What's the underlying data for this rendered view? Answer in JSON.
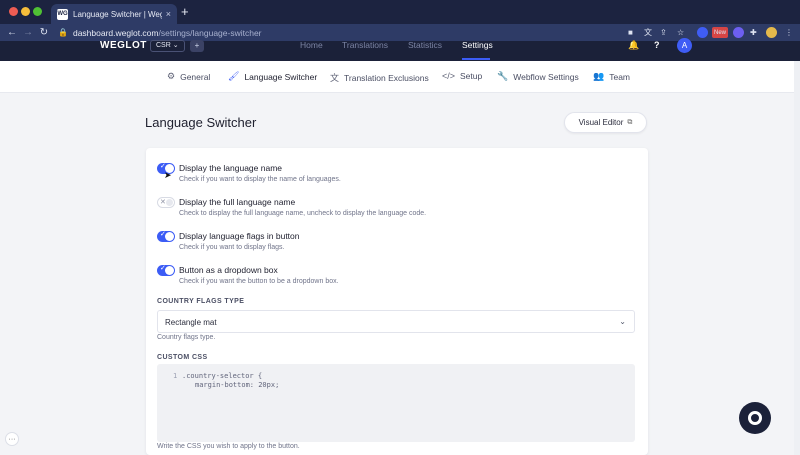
{
  "browser": {
    "tab_title": "Language Switcher | Weglot",
    "favicon_text": "WG",
    "new_tab_label": "+",
    "tab_close": "×",
    "url_host": "dashboard.weglot.com",
    "url_path": "/settings/language-switcher",
    "extension_badge": "New"
  },
  "app": {
    "logo": "WEGLOT",
    "project": "CSR ⌄",
    "project_add": "+",
    "nav": [
      "Home",
      "Translations",
      "Statistics",
      "Settings"
    ],
    "active_nav": "Settings",
    "avatar_initial": "A"
  },
  "subnav": [
    {
      "icon": "gear-icon",
      "glyph": "⚙",
      "label": "General",
      "active": false
    },
    {
      "icon": "paint-roller-icon",
      "glyph": "🖌",
      "label": "Language Switcher",
      "active": true
    },
    {
      "icon": "translate-icon",
      "glyph": "文",
      "label": "Translation Exclusions",
      "active": false
    },
    {
      "icon": "code-icon",
      "glyph": "</>",
      "label": "Setup",
      "active": false
    },
    {
      "icon": "wrench-icon",
      "glyph": "🔧",
      "label": "Webflow Settings",
      "active": false
    },
    {
      "icon": "team-icon",
      "glyph": "👥",
      "label": "Team",
      "active": false
    }
  ],
  "page": {
    "title": "Language Switcher",
    "visual_editor": "Visual Editor"
  },
  "options": [
    {
      "label": "Display the language name",
      "help": "Check if you want to display the name of languages.",
      "enabled": true
    },
    {
      "label": "Display the full language name",
      "help": "Check to display the full language name, uncheck to display the language code.",
      "enabled": false
    },
    {
      "label": "Display language flags in button",
      "help": "Check if you want to display flags.",
      "enabled": true
    },
    {
      "label": "Button as a dropdown box",
      "help": "Check if you want the button to be a dropdown box.",
      "enabled": true
    }
  ],
  "country_flags": {
    "section_label": "COUNTRY FLAGS TYPE",
    "selected": "Rectangle mat",
    "help": "Country flags type."
  },
  "custom_css": {
    "section_label": "CUSTOM CSS",
    "line_number": "1",
    "line1": ".country-selector {",
    "line2": "margin-bottom: 20px;",
    "help": "Write the CSS you wish to apply to the button."
  },
  "colors": {
    "accent": "#3c5cf5",
    "header": "#1b2139",
    "chrome": "#2e3b66"
  }
}
